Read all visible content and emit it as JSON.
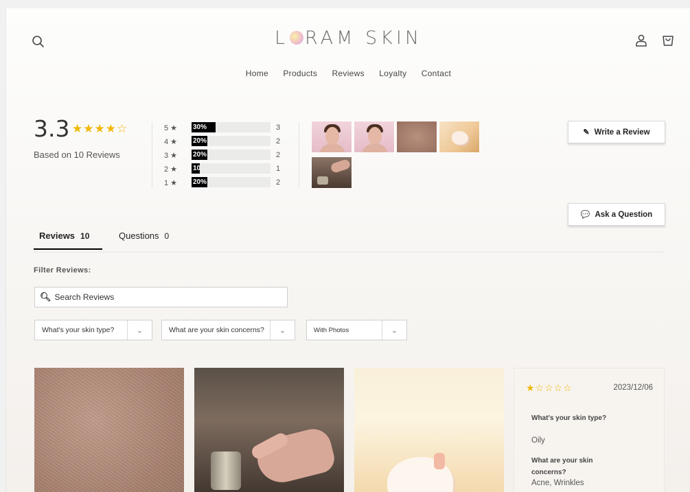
{
  "header": {
    "brand_left": "L",
    "brand_right": "RAM SKIN",
    "nav": [
      "Home",
      "Products",
      "Reviews",
      "Loyalty",
      "Contact"
    ]
  },
  "summary": {
    "average": "3.3",
    "average_stars": "★★★★☆",
    "based_on": "Based on 10 Reviews",
    "breakdown": [
      {
        "label": "5 ★",
        "percent_text": "30%",
        "percent": 30,
        "count": "3"
      },
      {
        "label": "4 ★",
        "percent_text": "20%",
        "percent": 20,
        "count": "2"
      },
      {
        "label": "3 ★",
        "percent_text": "20%",
        "percent": 20,
        "count": "2"
      },
      {
        "label": "2 ★",
        "percent_text": "10%",
        "percent": 10,
        "count": "1"
      },
      {
        "label": "1 ★",
        "percent_text": "20%",
        "percent": 20,
        "count": "2"
      }
    ]
  },
  "actions": {
    "write_review": "Write a Review",
    "ask_question": "Ask a Question"
  },
  "tabs": [
    {
      "label": "Reviews",
      "count": "10"
    },
    {
      "label": "Questions",
      "count": "0"
    }
  ],
  "filters": {
    "heading": "Filter Reviews:",
    "search_placeholder": "Search Reviews",
    "selects": [
      "What's your skin type?",
      "What are your skin concerns?",
      "With Photos"
    ]
  },
  "review": {
    "stars": "★☆☆☆☆",
    "date": "2023/12/06",
    "q1": "What's your skin type?",
    "a1": "Oily",
    "q2": "What are your skin concerns?",
    "a2": "Acne, Wrinkles"
  },
  "colors": {
    "star": "#f2b705",
    "bar_fill": "#000000",
    "bar_track": "#ebebea"
  }
}
